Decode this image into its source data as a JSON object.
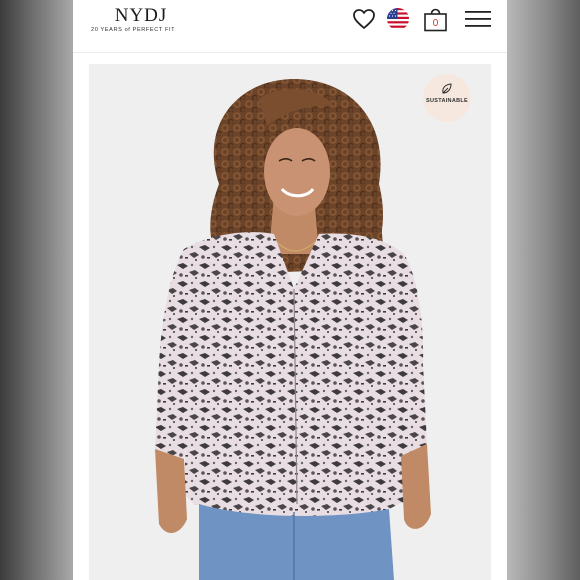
{
  "header": {
    "brand": "NYDJ",
    "tagline": "20 YEARS of PERFECT FIT"
  },
  "icons": {
    "wishlist": "heart-icon",
    "region": "us-flag-icon",
    "cart": "shopping-bag-icon",
    "menu": "hamburger-menu-icon",
    "badge": "leaf-icon"
  },
  "cart": {
    "count": "0"
  },
  "product": {
    "badge_label": "SUSTAINABLE",
    "image_alt": "Model wearing a snake-print three-quarter sleeve blouse with jeans"
  },
  "colors": {
    "badge_bg": "#f6e8df",
    "print_dark": "#3e3a3d",
    "print_light": "#e8dde2"
  }
}
